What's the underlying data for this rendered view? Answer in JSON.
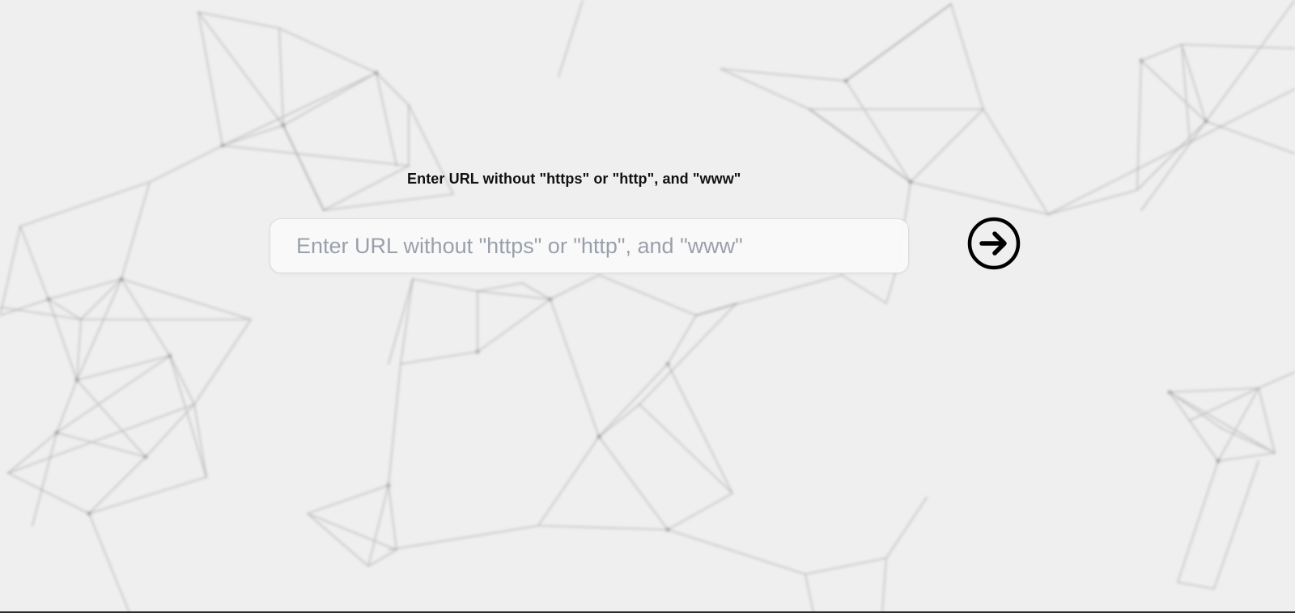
{
  "form": {
    "label": "Enter URL without \"https\" or \"http\", and \"www\"",
    "input": {
      "value": "",
      "placeholder": "Enter URL without \"https\" or \"http\", and \"www\""
    },
    "submit_icon": "arrow-right-circle-icon"
  },
  "colors": {
    "background": "#efefef",
    "network_lines": "#8c8c8c",
    "label_text": "#111111",
    "placeholder_text": "#9aa0ab",
    "icon": "#000000"
  }
}
